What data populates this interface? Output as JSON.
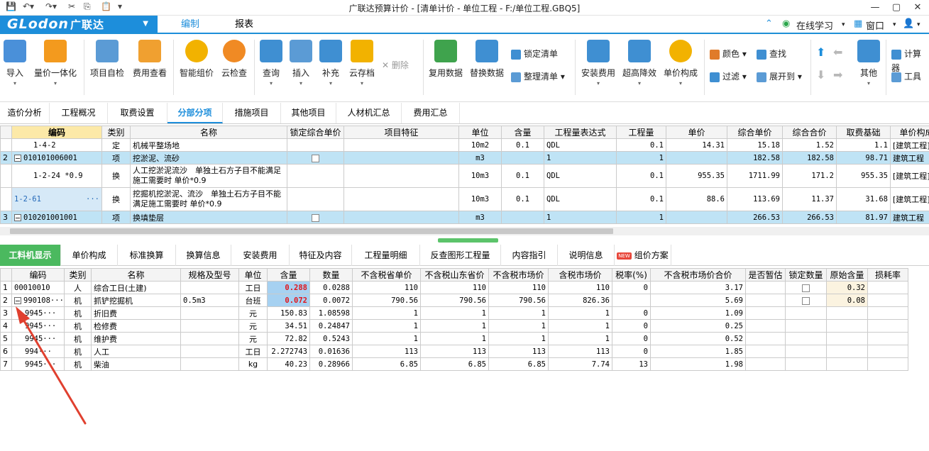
{
  "window": {
    "title": "广联达预算计价 - [清单计价 - 单位工程 - F:/单位工程.GBQ5]",
    "controls": [
      "—",
      "▢",
      "✕"
    ]
  },
  "brand": {
    "logo_latin": "GLodon",
    "logo_cn": "广联达",
    "main_tabs": [
      "编制",
      "报表"
    ],
    "active_tab": "编制",
    "online_learning": "在线学习",
    "window_menu": "窗口"
  },
  "ribbon": {
    "buttons": [
      {
        "label": "导入",
        "icon": "import-icon",
        "color": "#4a90d9"
      },
      {
        "label": "量价一体化",
        "icon": "integration-icon",
        "color": "#f39a1e"
      },
      {
        "label": "项目自检",
        "icon": "self-check-icon",
        "color": "#5b9bd5"
      },
      {
        "label": "费用查看",
        "icon": "fee-view-icon",
        "color": "#f0a030"
      },
      {
        "label": "智能组价",
        "icon": "smart-price-icon",
        "color": "#f2b200"
      },
      {
        "label": "云检查",
        "icon": "cloud-check-icon",
        "color": "#f08a24"
      },
      {
        "label": "查询",
        "icon": "query-icon",
        "color": "#3f8fd2"
      },
      {
        "label": "插入",
        "icon": "insert-icon",
        "color": "#5b9bd5"
      },
      {
        "label": "补充",
        "icon": "supplement-icon",
        "color": "#3f8fd2"
      },
      {
        "label": "云存档",
        "icon": "cloud-archive-icon",
        "color": "#f2b200"
      },
      {
        "label": "复用数据",
        "icon": "reuse-data-icon",
        "color": "#3fa34d"
      },
      {
        "label": "替换数据",
        "icon": "replace-data-icon",
        "color": "#3f8fd2"
      },
      {
        "label": "安装费用",
        "icon": "install-fee-icon",
        "color": "#3f8fd2"
      },
      {
        "label": "超高降效",
        "icon": "height-efficiency-icon",
        "color": "#3f8fd2"
      },
      {
        "label": "单价构成",
        "icon": "unit-price-icon",
        "color": "#f2b200"
      },
      {
        "label": "其他",
        "icon": "other-icon",
        "color": "#3f8fd2"
      }
    ],
    "delete_label": "删除",
    "lock_list": "锁定清单",
    "organize_list": "整理清单",
    "color_label": "颜色",
    "search_label": "查找",
    "filter_label": "过滤",
    "expand_label": "展开到",
    "calc_label": "计算器",
    "tools_label": "工具"
  },
  "subtabs": [
    "造价分析",
    "工程概况",
    "取费设置",
    "分部分项",
    "措施项目",
    "其他项目",
    "人材机汇总",
    "费用汇总"
  ],
  "active_subtab": "分部分项",
  "upper_grid": {
    "headers": [
      "编码",
      "类别",
      "名称",
      "锁定综合单价",
      "项目特征",
      "单位",
      "含量",
      "工程量表达式",
      "工程量",
      "单价",
      "综合单价",
      "综合合价",
      "取费基础",
      "单价构成文"
    ],
    "rows": [
      {
        "no": "",
        "code": "1-4-2",
        "type": "定",
        "name": "机械平整场地",
        "lock": "",
        "feature": "",
        "unit": "10m2",
        "qty_ratio": "0.1",
        "expr": "QDL",
        "qty": "0.1",
        "price": "14.31",
        "comp_price": "15.18",
        "comp_total": "1.52",
        "base": "1.1",
        "composition": "[建筑工程]"
      },
      {
        "no": "2",
        "code": "010101006001",
        "type": "项",
        "name": "挖淤泥、流砂",
        "lock": "checkbox",
        "feature": "",
        "unit": "m3",
        "qty_ratio": "",
        "expr": "1",
        "qty": "1",
        "price": "",
        "comp_price": "182.58",
        "comp_total": "182.58",
        "base": "98.71",
        "composition": "建筑工程"
      },
      {
        "no": "",
        "code": "1-2-24 *0.9",
        "type": "换",
        "name": "人工挖淤泥流沙　单独土石方子目不能满足施工需要时 单价*0.9",
        "lock": "",
        "feature": "",
        "unit": "10m3",
        "qty_ratio": "0.1",
        "expr": "QDL",
        "qty": "0.1",
        "price": "955.35",
        "comp_price": "1711.99",
        "comp_total": "171.2",
        "base": "955.35",
        "composition": "[建筑工程]"
      },
      {
        "no": "",
        "code": "1-2-61",
        "type": "换",
        "name": "挖掘机挖淤泥、流沙　单独土石方子目不能满足施工需要时 单价*0.9",
        "lock": "",
        "feature": "",
        "unit": "10m3",
        "qty_ratio": "0.1",
        "expr": "QDL",
        "qty": "0.1",
        "price": "88.6",
        "comp_price": "113.69",
        "comp_total": "11.37",
        "base": "31.68",
        "composition": "[建筑工程]"
      },
      {
        "no": "3",
        "code": "010201001001",
        "type": "项",
        "name": "换填垫层",
        "lock": "checkbox",
        "feature": "",
        "unit": "m3",
        "qty_ratio": "",
        "expr": "1",
        "qty": "1",
        "price": "",
        "comp_price": "266.53",
        "comp_total": "266.53",
        "base": "81.97",
        "composition": "建筑工程"
      }
    ]
  },
  "bottom_tabs": [
    "工料机显示",
    "单价构成",
    "标准换算",
    "换算信息",
    "安装费用",
    "特征及内容",
    "工程量明细",
    "反查图形工程量",
    "内容指引",
    "说明信息",
    "组价方案"
  ],
  "active_bottom_tab": "工料机显示",
  "new_badge": "NEW",
  "lower_grid": {
    "headers": [
      "编码",
      "类别",
      "名称",
      "规格及型号",
      "单位",
      "含量",
      "数量",
      "不含税省单价",
      "不含税山东省价",
      "不含税市场价",
      "含税市场价",
      "税率(%)",
      "不含税市场价合价",
      "是否暂估",
      "锁定数量",
      "原始含量",
      "损耗率"
    ],
    "rows": [
      {
        "no": "1",
        "code": "00010010",
        "type": "人",
        "name": "综合工日(土建)",
        "spec": "",
        "unit": "工日",
        "ratio": "0.288",
        "qty": "0.0288",
        "p1": "110",
        "p2": "110",
        "p3": "110",
        "p4": "110",
        "tax": "0",
        "total": "3.17",
        "est": "",
        "lock": "checkbox",
        "orig": "0.32",
        "loss": ""
      },
      {
        "no": "2",
        "code": "990108···",
        "type": "机",
        "name": "抓铲挖掘机",
        "spec": "0.5m3",
        "unit": "台班",
        "ratio": "0.072",
        "qty": "0.0072",
        "p1": "790.56",
        "p2": "790.56",
        "p3": "790.56",
        "p4": "826.36",
        "tax": "",
        "total": "5.69",
        "est": "",
        "lock": "checkbox",
        "orig": "0.08",
        "loss": ""
      },
      {
        "no": "3",
        "code": "9945···",
        "type": "机",
        "name": "折旧费",
        "spec": "",
        "unit": "元",
        "ratio": "150.83",
        "qty": "1.08598",
        "p1": "1",
        "p2": "1",
        "p3": "1",
        "p4": "1",
        "tax": "0",
        "total": "1.09",
        "est": "",
        "lock": "",
        "orig": "",
        "loss": ""
      },
      {
        "no": "4",
        "code": "9945···",
        "type": "机",
        "name": "检修费",
        "spec": "",
        "unit": "元",
        "ratio": "34.51",
        "qty": "0.24847",
        "p1": "1",
        "p2": "1",
        "p3": "1",
        "p4": "1",
        "tax": "0",
        "total": "0.25",
        "est": "",
        "lock": "",
        "orig": "",
        "loss": ""
      },
      {
        "no": "5",
        "code": "9945···",
        "type": "机",
        "name": "维护费",
        "spec": "",
        "unit": "元",
        "ratio": "72.82",
        "qty": "0.5243",
        "p1": "1",
        "p2": "1",
        "p3": "1",
        "p4": "1",
        "tax": "0",
        "total": "0.52",
        "est": "",
        "lock": "",
        "orig": "",
        "loss": ""
      },
      {
        "no": "6",
        "code": "994···",
        "type": "机",
        "name": "人工",
        "spec": "",
        "unit": "工日",
        "ratio": "2.272743",
        "qty": "0.01636",
        "p1": "113",
        "p2": "113",
        "p3": "113",
        "p4": "113",
        "tax": "0",
        "total": "1.85",
        "est": "",
        "lock": "",
        "orig": "",
        "loss": ""
      },
      {
        "no": "7",
        "code": "9945···",
        "type": "机",
        "name": "柴油",
        "spec": "",
        "unit": "kg",
        "ratio": "40.23",
        "qty": "0.28966",
        "p1": "6.85",
        "p2": "6.85",
        "p3": "6.85",
        "p4": "7.74",
        "tax": "13",
        "total": "1.98",
        "est": "",
        "lock": "",
        "orig": "",
        "loss": ""
      }
    ]
  },
  "colors": {
    "brand_blue": "#1d8edb",
    "active_green": "#4bb95f",
    "row_highlight": "#bfe3f5",
    "annotation_red": "#e0402f",
    "value_red": "#e0151b"
  }
}
